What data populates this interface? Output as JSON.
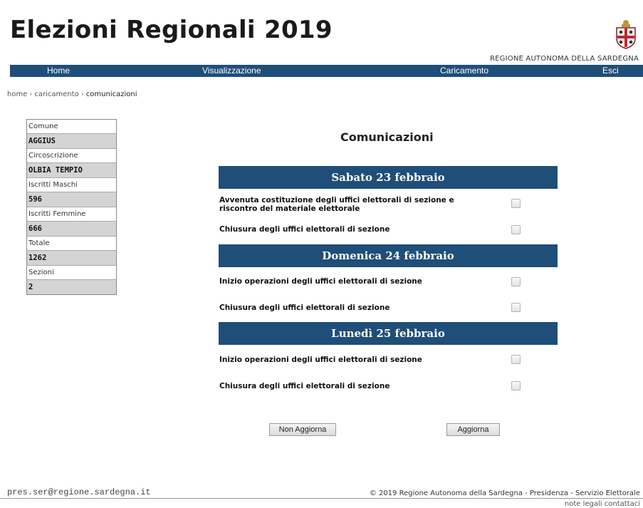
{
  "header": {
    "title": "Elezioni Regionali 2019",
    "region": "REGIONE AUTONOMA DELLA SARDEGNA"
  },
  "nav": {
    "home": "Home",
    "visualizzazione": "Visualizzazione",
    "caricamento": "Caricamento",
    "esci": "Esci"
  },
  "breadcrumb": {
    "home": "home",
    "caricamento": "caricamento",
    "current": "comunicazioni",
    "separator": "›"
  },
  "info": {
    "comune_label": "Comune",
    "comune_value": "AGGIUS",
    "circoscrizione_label": "Circoscrizione",
    "circoscrizione_value": "OLBIA TEMPIO",
    "maschi_label": "Iscritti Maschi",
    "maschi_value": "596",
    "femmine_label": "Iscritti Femmine",
    "femmine_value": "666",
    "totale_label": "Totale",
    "totale_value": "1262",
    "sezioni_label": "Sezioni",
    "sezioni_value": "2"
  },
  "main": {
    "heading": "Comunicazioni",
    "days": [
      {
        "title": "Sabato 23 febbraio",
        "rows": [
          {
            "label": "Avvenuta costituzione degli uffici elettorali di sezione e riscontro del materiale elettorale",
            "checked": false
          },
          {
            "label": "Chiusura degli uffici elettorali di sezione",
            "checked": false
          }
        ]
      },
      {
        "title": "Domenica 24 febbraio",
        "rows": [
          {
            "label": "Inizio operazioni degli uffici elettorali di sezione",
            "checked": false
          },
          {
            "label": "Chiusura degli uffici elettorali di sezione",
            "checked": false
          }
        ]
      },
      {
        "title": "Lunedì 25 febbraio",
        "rows": [
          {
            "label": "Inizio operazioni degli uffici elettorali di sezione",
            "checked": false
          },
          {
            "label": "Chiusura degli uffici elettorali di sezione",
            "checked": false
          }
        ]
      }
    ],
    "buttons": {
      "non_aggiorna": "Non Aggiorna",
      "aggiorna": "Aggiorna"
    }
  },
  "footer": {
    "email": "pres.ser@regione.sardegna.it",
    "copyright": "© 2019 Regione Autonoma della Sardegna - Presidenza - Servizio Elettorale",
    "links": "note legali contattaci"
  },
  "colors": {
    "navbar": "#1f4e79",
    "day_header": "#1f4e79",
    "info_value_bg": "#d4d4d4"
  },
  "icons": {
    "crest": "regione-sardegna-crest-icon"
  }
}
